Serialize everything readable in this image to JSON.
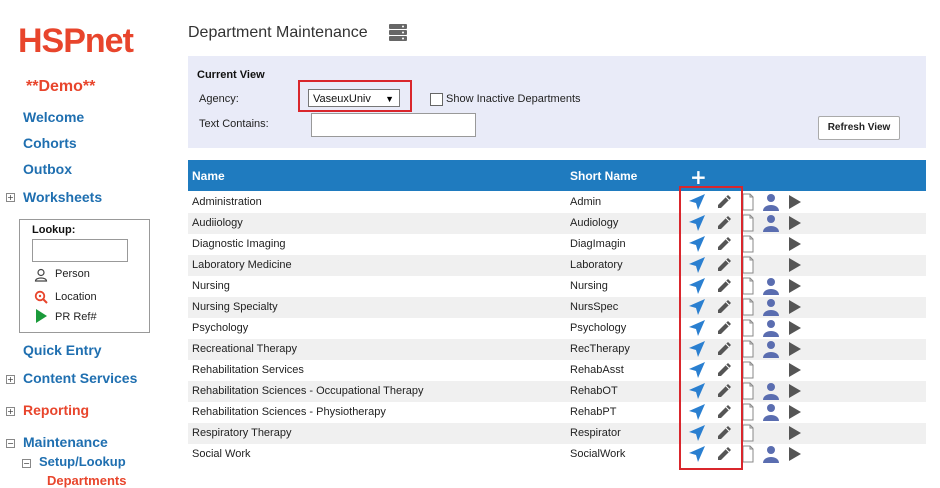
{
  "logo": "HSPnet",
  "demo_label": "**Demo**",
  "sidebar": {
    "welcome": "Welcome",
    "cohorts": "Cohorts",
    "outbox": "Outbox",
    "worksheets": "Worksheets",
    "lookup_title": "Lookup:",
    "lookup_person": "Person",
    "lookup_location": "Location",
    "lookup_pr_ref": "PR Ref#",
    "quick_entry": "Quick Entry",
    "content_services": "Content Services",
    "reporting": "Reporting",
    "maintenance": "Maintenance",
    "setup_lookup": "Setup/Lookup",
    "departments": "Departments",
    "expand_symbol": "+",
    "collapse_symbol": "−"
  },
  "main": {
    "title": "Department Maintenance",
    "current_view_label": "Current View",
    "agency_label": "Agency:",
    "agency_value": "VaseuxUniv",
    "show_inactive_label": "Show Inactive Departments",
    "text_contains_label": "Text Contains:",
    "text_contains_value": "",
    "refresh_button": "Refresh View"
  },
  "table": {
    "columns": {
      "name": "Name",
      "short_name": "Short Name",
      "add": "+"
    },
    "rows": [
      {
        "name": "Administration",
        "short": "Admin",
        "person": true
      },
      {
        "name": "Audiiology",
        "short": "Audiology",
        "person": true
      },
      {
        "name": "Diagnostic Imaging",
        "short": "DiagImagin",
        "person": false
      },
      {
        "name": "Laboratory Medicine",
        "short": "Laboratory",
        "person": false
      },
      {
        "name": "Nursing",
        "short": "Nursing",
        "person": true
      },
      {
        "name": "Nursing Specialty",
        "short": "NursSpec",
        "person": true
      },
      {
        "name": "Psychology",
        "short": "Psychology",
        "person": true
      },
      {
        "name": "Recreational Therapy",
        "short": "RecTherapy",
        "person": true
      },
      {
        "name": "Rehabilitation Services",
        "short": "RehabAsst",
        "person": false
      },
      {
        "name": "Rehabilitation Sciences - Occupational Therapy",
        "short": "RehabOT",
        "person": true
      },
      {
        "name": "Rehabilitation Sciences - Physiotherapy",
        "short": "RehabPT",
        "person": true
      },
      {
        "name": "Respiratory Therapy",
        "short": "Respirator",
        "person": false
      },
      {
        "name": "Social Work",
        "short": "SocialWork",
        "person": true
      }
    ]
  },
  "colors": {
    "brand_red": "#e8452c",
    "link_blue": "#1f6fb0",
    "header_blue": "#1f7bbf",
    "highlight_red": "#d9262c",
    "icon_blue": "#2a7fd0",
    "person_icon": "#5a6db0"
  }
}
